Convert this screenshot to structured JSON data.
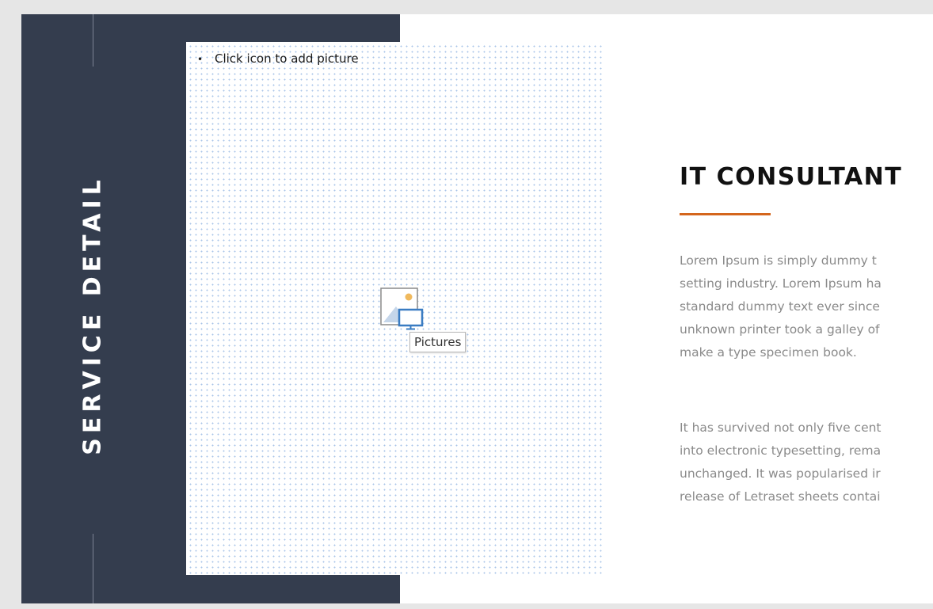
{
  "sidebar": {
    "title": "SERVICE DETAIL"
  },
  "placeholder": {
    "prompt": "Click icon to add picture",
    "icon": "pictures-insert-icon",
    "tooltip": "Pictures"
  },
  "content": {
    "heading": "IT CONSULTANT",
    "paragraph1": [
      "Lorem Ipsum is simply dummy t",
      "setting industry. Lorem Ipsum ha",
      "standard dummy text ever since",
      "unknown printer took a galley of",
      "make a type specimen book."
    ],
    "paragraph2": [
      "It has survived not only five cent",
      "into electronic typesetting, rema",
      "unchanged. It was popularised ir",
      "release of Letraset sheets contai"
    ]
  },
  "colors": {
    "panel": "#343d4e",
    "accent": "#d4661c",
    "body_text": "#8a8a8a"
  }
}
